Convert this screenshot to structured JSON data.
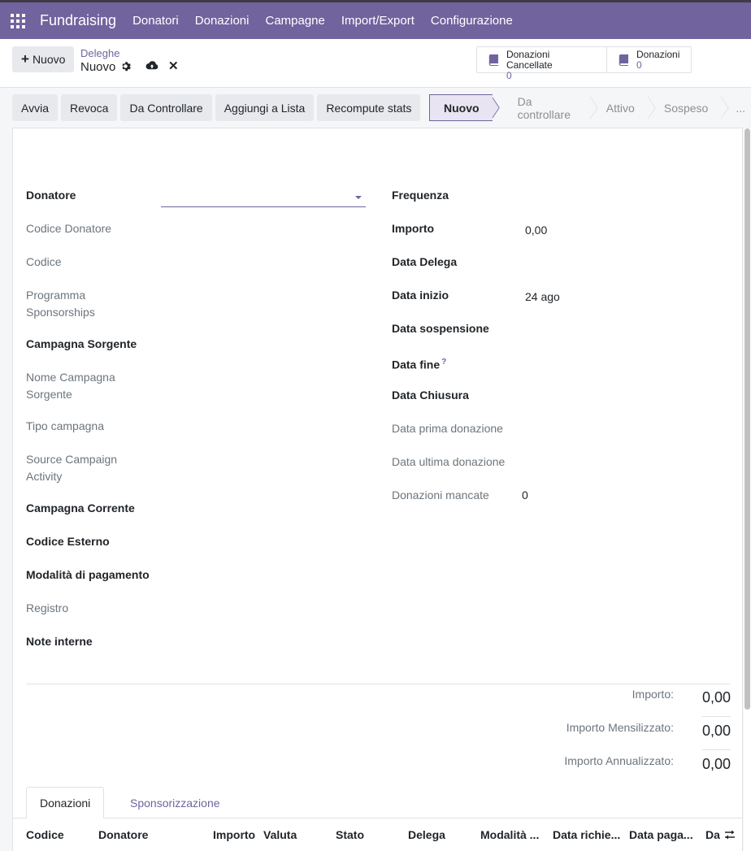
{
  "navbar": {
    "brand": "Fundraising",
    "menu": [
      "Donatori",
      "Donazioni",
      "Campagne",
      "Import/Export",
      "Configurazione"
    ]
  },
  "control_panel": {
    "new_label": "Nuovo",
    "breadcrumb_parent": "Deleghe",
    "breadcrumb_current": "Nuovo",
    "stat_buttons": [
      {
        "label": "Donazioni Cancellate",
        "value": "0"
      },
      {
        "label": "Donazioni",
        "value": "0"
      }
    ]
  },
  "actions": [
    "Avvia",
    "Revoca",
    "Da Controllare",
    "Aggiungi a Lista",
    "Recompute stats"
  ],
  "status_stages": [
    "Nuovo",
    "Da controllare",
    "Attivo",
    "Sospeso",
    "..."
  ],
  "form": {
    "left": {
      "donatore": "Donatore",
      "codice_donatore": "Codice Donatore",
      "codice": "Codice",
      "programma_1": "Programma",
      "programma_2": "Sponsorships",
      "campagna_sorgente": "Campagna Sorgente",
      "nome_campagna_1": "Nome Campagna",
      "nome_campagna_2": "Sorgente",
      "tipo_campagna": "Tipo campagna",
      "source_activity_1": "Source Campaign",
      "source_activity_2": "Activity",
      "campagna_corrente": "Campagna Corrente",
      "codice_esterno": "Codice Esterno",
      "modalita_pagamento": "Modalità di pagamento",
      "registro": "Registro",
      "note_interne": "Note interne"
    },
    "right": {
      "frequenza": "Frequenza",
      "importo": "Importo",
      "importo_value": "0,00",
      "data_delega": "Data Delega",
      "data_inizio": "Data inizio",
      "data_inizio_value": "24 ago",
      "data_sospensione": "Data sospensione",
      "data_fine": "Data fine",
      "data_fine_help": "?",
      "data_chiusura": "Data Chiusura",
      "data_prima_donazione": "Data prima donazione",
      "data_ultima_donazione": "Data ultima donazione",
      "donazioni_mancate": "Donazioni mancate",
      "donazioni_mancate_value": "0"
    }
  },
  "totals": [
    {
      "label": "Importo:",
      "value": "0,00"
    },
    {
      "label": "Importo Mensilizzato:",
      "value": "0,00"
    },
    {
      "label": "Importo Annualizzato:",
      "value": "0,00"
    }
  ],
  "tabs": [
    "Donazioni",
    "Sponsorizzazione"
  ],
  "table_headers": [
    "Codice",
    "Donatore",
    "Importo",
    "Valuta",
    "Stato",
    "Delega",
    "Modalità ...",
    "Data richie...",
    "Data paga...",
    "Da"
  ]
}
